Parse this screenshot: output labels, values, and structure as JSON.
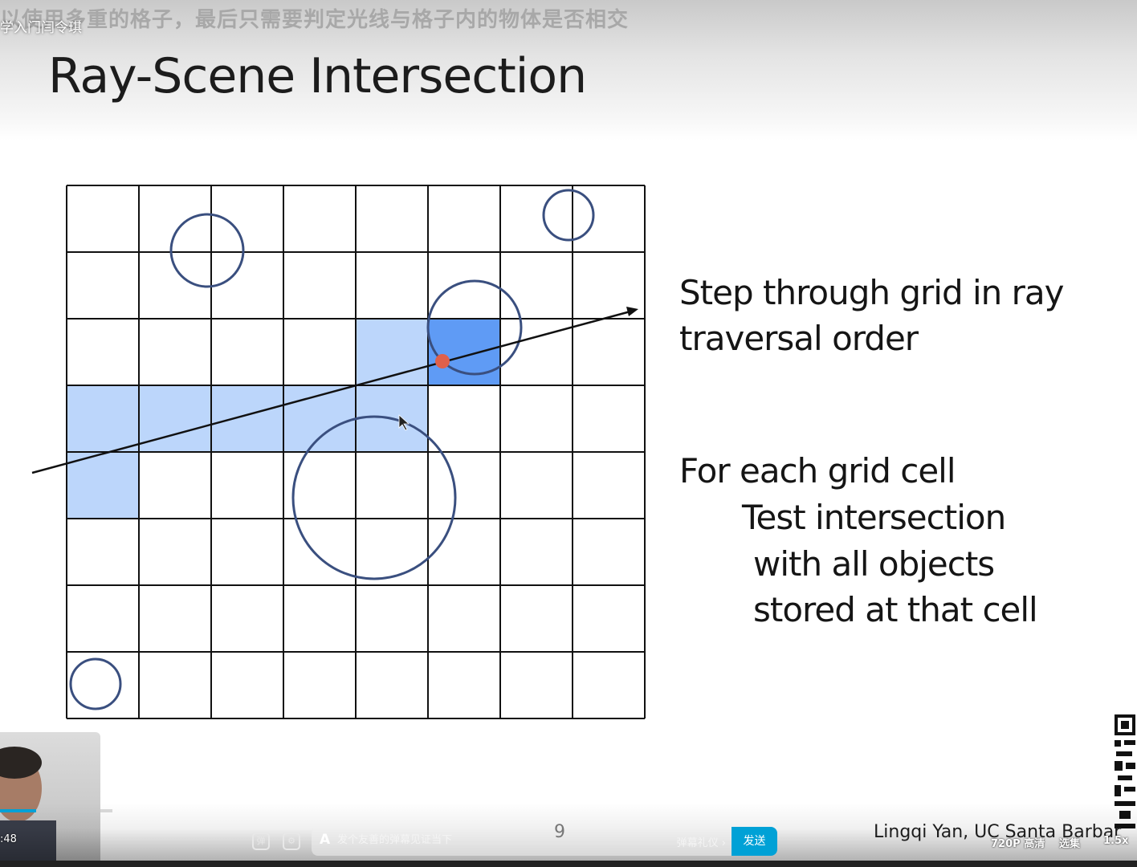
{
  "video": {
    "subtitle": "以使用多重的格子，最后只需要判定光线与格子内的物体是否相交",
    "course_title": "学入门闫令琪"
  },
  "slide": {
    "title": "Ray-Scene Intersection",
    "step_line1": "Step through grid in ray",
    "step_line2": "traversal order",
    "for_line": "For each grid cell",
    "test_line": "Test intersection",
    "with_line": "with all objects",
    "stored_line": "stored at that cell",
    "page_number": "9",
    "author": "Lingqi Yan, UC Santa Barbar"
  },
  "grid": {
    "cols": 8,
    "rows": 8,
    "highlighted_cells": [
      [
        0,
        3
      ],
      [
        1,
        3
      ],
      [
        2,
        3
      ],
      [
        3,
        3
      ],
      [
        4,
        3
      ],
      [
        0,
        4
      ],
      [
        4,
        2
      ]
    ],
    "hit_cell": [
      5,
      2
    ],
    "light_color": "#bcd6fb",
    "hit_color": "#5f9bf5",
    "circle_color": "#3a4f7f",
    "hit_point_color": "#e0604a"
  },
  "player": {
    "time": ":48",
    "progress_fraction": 0.32,
    "danmaku_placeholder": "发个友善的弹幕见证当下",
    "danmaku_gift": "弹幕礼仪 ›",
    "send_label": "发送",
    "quality": "720P 高清",
    "episodes": "选集",
    "speed": "1.5x"
  }
}
